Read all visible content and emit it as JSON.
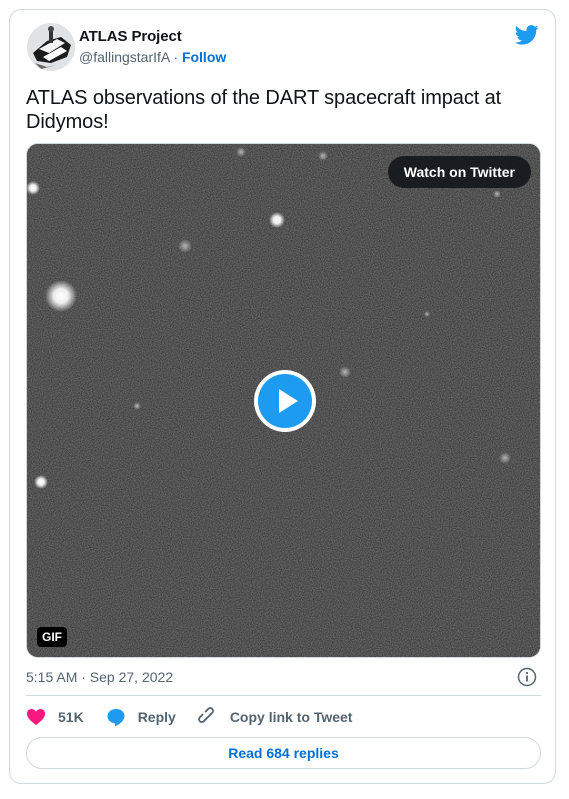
{
  "author": {
    "name": "ATLAS Project",
    "handle": "@fallingstarIfA",
    "separator": " · ",
    "follow_label": "Follow"
  },
  "tweet": {
    "text": "ATLAS observations of the DART spacecraft impact at Didymos!",
    "timestamp": "5:15 AM · Sep 27, 2022"
  },
  "media": {
    "watch_label": "Watch on Twitter",
    "badge": "GIF"
  },
  "actions": {
    "like_count": "51K",
    "reply_label": "Reply",
    "copy_link_label": "Copy link to Tweet",
    "read_replies_label": "Read 684 replies"
  },
  "colors": {
    "twitter_blue": "#1d9bf0",
    "like_pink": "#f91880",
    "link_blue": "#006fd6"
  }
}
